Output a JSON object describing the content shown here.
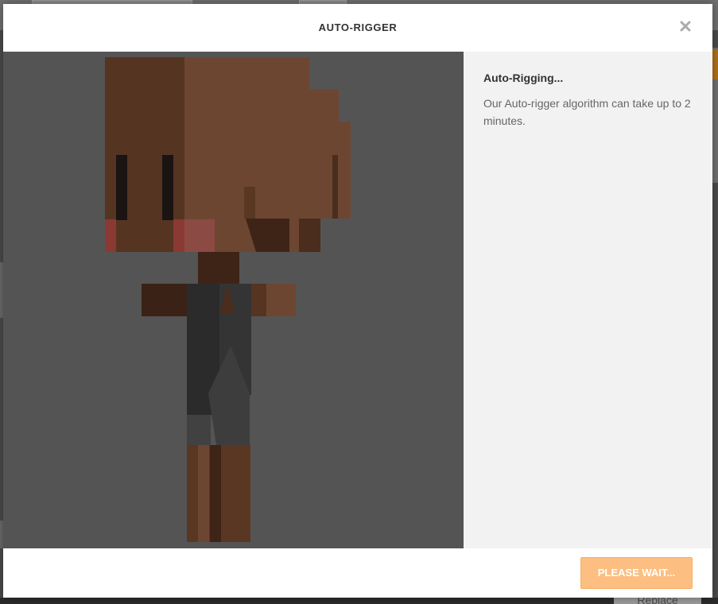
{
  "background": {
    "replace_label": "Replace"
  },
  "modal": {
    "title": "AUTO-RIGGER",
    "close_icon": "close-icon",
    "status": {
      "heading": "Auto-Rigging...",
      "text": "Our Auto-rigger algorithm can take up to 2 minutes."
    },
    "footer": {
      "button_label": "PLEASE WAIT...",
      "button_color": "#fcbf81"
    }
  },
  "colors": {
    "preview_background": "#545454",
    "info_background": "#f2f2f2"
  }
}
